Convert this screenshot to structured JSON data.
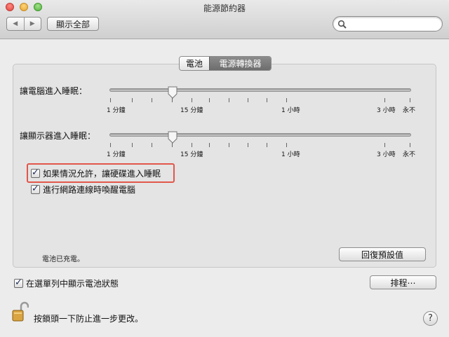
{
  "window": {
    "title": "能源節約器"
  },
  "toolbar": {
    "back_icon": "triangle-left-icon",
    "forward_icon": "triangle-right-icon",
    "show_all_label": "顯示全部",
    "search_value": "",
    "search_icon": "magnifier-icon"
  },
  "tabs": [
    {
      "label": "電池",
      "selected": false
    },
    {
      "label": "電源轉換器",
      "selected": true
    }
  ],
  "sliders": {
    "computer": {
      "label": "讓電腦進入睡眠：",
      "value": "15 分鐘",
      "ticks": [
        "1 分鐘",
        "15 分鐘",
        "1 小時",
        "3 小時",
        "永不"
      ]
    },
    "display": {
      "label": "讓顯示器進入睡眠：",
      "value": "15 分鐘",
      "ticks": [
        "1 分鐘",
        "15 分鐘",
        "1 小時",
        "3 小時",
        "永不"
      ]
    }
  },
  "options": {
    "disk_sleep": {
      "label": "如果情況允許，讓硬碟進入睡眠",
      "checked": true
    },
    "wake_network": {
      "label": "進行網路連線時喚醒電腦",
      "checked": true
    }
  },
  "status_text": "電池已充電。",
  "restore_defaults_label": "回復預設值",
  "show_battery_status": {
    "label": "在選單列中顯示電池狀態",
    "checked": true
  },
  "schedule_label": "排程⋯",
  "lock_text": "按鎖頭一下防止進一步更改。",
  "help_label": "?",
  "colors": {
    "highlight": "#e2564a",
    "selected_tab": "#6d6d6d"
  }
}
